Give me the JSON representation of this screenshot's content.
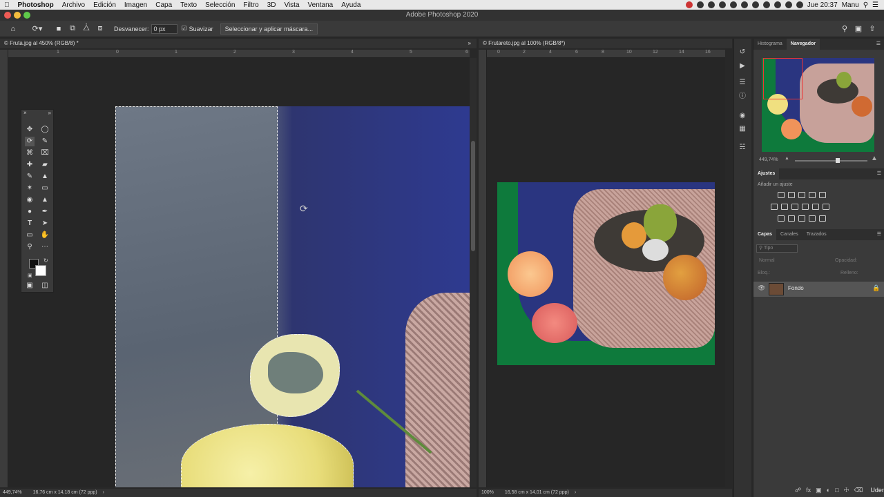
{
  "menubar": {
    "app": "Photoshop",
    "items": [
      "Archivo",
      "Edición",
      "Imagen",
      "Capa",
      "Texto",
      "Selección",
      "Filtro",
      "3D",
      "Vista",
      "Ventana",
      "Ayuda"
    ],
    "clock": "Jue 20:37",
    "user": "Manu"
  },
  "window_title": "Adobe Photoshop 2020",
  "options": {
    "feather_label": "Desvanecer:",
    "feather_value": "0 px",
    "smooth_label": "Suavizar",
    "mask_button": "Seleccionar y aplicar máscara..."
  },
  "doc1": {
    "tab": "© Fruta.jpg al 450% (RGB/8) *",
    "ruler_h": [
      "1",
      "0",
      "1",
      "2",
      "3",
      "4",
      "5",
      "6"
    ],
    "zoom": "449,74%",
    "size": "16,76 cm x 14,18 cm (72 ppp)"
  },
  "doc2": {
    "tab": "© Frutareto.jpg al 100% (RGB/8*)",
    "ruler_h": [
      "0",
      "2",
      "4",
      "6",
      "8",
      "10",
      "12",
      "14",
      "16"
    ],
    "zoom": "100%",
    "size": "16,58 cm x 14,01 cm (72 ppp)"
  },
  "panels": {
    "nav_tabs": [
      "Histograma",
      "Navegador"
    ],
    "nav_zoom": "449,74%",
    "adj_title": "Ajustes",
    "adj_add": "Añadir un ajuste",
    "layer_tabs": [
      "Capas",
      "Canales",
      "Trazados"
    ],
    "search_placeholder": "Tipo",
    "blend": "Normal",
    "opacity_label": "Opacidad:",
    "lock_label": "Bloq.:",
    "fill_label": "Relleno:",
    "layer_name": "Fondo"
  },
  "watermark": "Udemy"
}
